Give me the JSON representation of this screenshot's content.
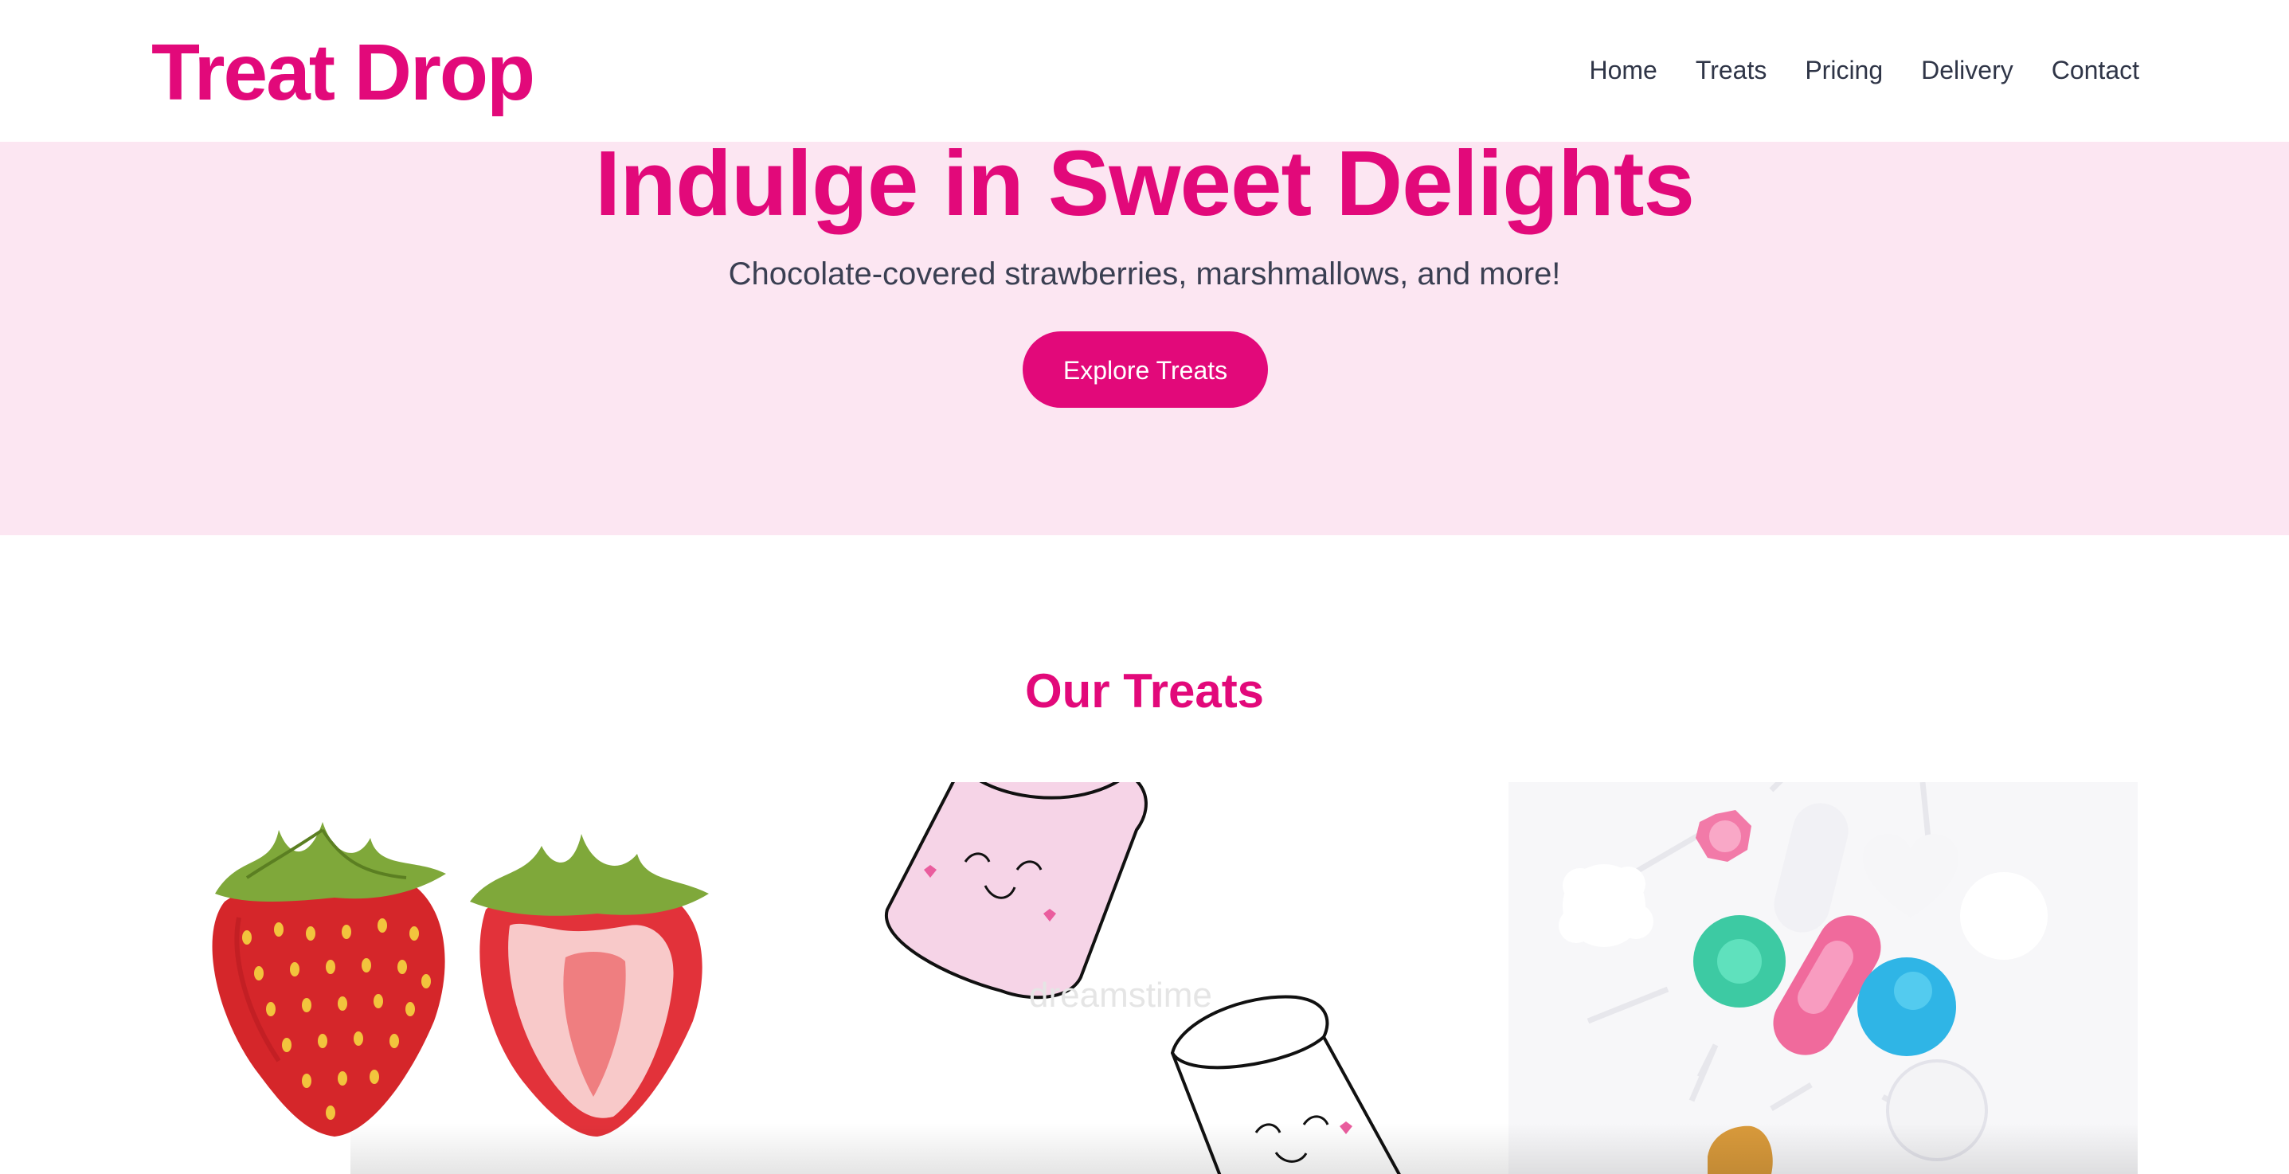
{
  "brand": {
    "name": "Treat Drop",
    "accent_color": "#e2097a",
    "hero_background": "#fce6f2"
  },
  "nav": {
    "items": [
      {
        "label": "Home"
      },
      {
        "label": "Treats"
      },
      {
        "label": "Pricing"
      },
      {
        "label": "Delivery"
      },
      {
        "label": "Contact"
      }
    ]
  },
  "hero": {
    "title": "Indulge in Sweet Delights",
    "subtitle": "Chocolate-covered strawberries, marshmallows, and more!",
    "button_label": "Explore Treats"
  },
  "treats_section": {
    "title": "Our Treats",
    "cards": [
      {
        "image": "strawberries-illustration"
      },
      {
        "image": "marshmallows-illustration",
        "watermark": "dreamstime"
      },
      {
        "image": "lollipops-photo"
      }
    ]
  }
}
